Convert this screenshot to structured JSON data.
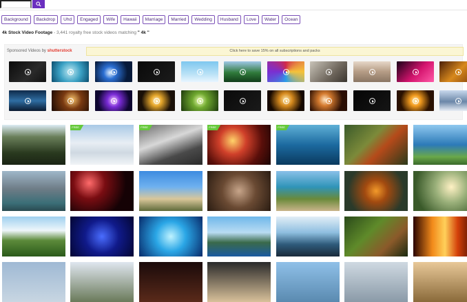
{
  "search": {
    "placeholder": ""
  },
  "tags": [
    "Background",
    "Backdrop",
    "Uhd",
    "Engaged",
    "Wife",
    "Hawaii",
    "Marriage",
    "Married",
    "Wedding",
    "Husband",
    "Love",
    "Water",
    "Ocean"
  ],
  "heading": {
    "title": "4k Stock Video Footage",
    "subtitle": " - 3,441 royalty free stock videos matching ",
    "query": "\" 4k \""
  },
  "sponsor": {
    "label_prefix": "Sponsored Videos by ",
    "brand": "shutterstock",
    "promo": "Click here to save 15% on all subscriptions and packs"
  },
  "sponsored_videos": {
    "row1": [
      {
        "gradient": "linear-gradient(135deg,#0b0b0b,#2a2a2a 60%,#111)"
      },
      {
        "gradient": "radial-gradient(circle at 50% 50%,#bfe9f2,#3ba1c4 50%,#0b4d6e)"
      },
      {
        "gradient": "radial-gradient(circle at 40% 55%,#dfefff,#2b6fd3 25%,#071a3a 70%)"
      },
      {
        "gradient": "linear-gradient(135deg,#0a0a0a,#1b1b1b)"
      },
      {
        "gradient": "linear-gradient(180deg,#7ec7ef,#b8e1f6 60%,#e8f5ff)"
      },
      {
        "gradient": "linear-gradient(180deg,#9ec7e6,#2f7a3a 55%,#123d1a)"
      },
      {
        "gradient": "conic-gradient(from 0deg,#d02a4b,#f5c23a,#2b9ce8,#7a2fd1,#d02a4b)"
      },
      {
        "gradient": "linear-gradient(135deg,#c8c3b8,#6f675d 60%,#3a352e)"
      },
      {
        "gradient": "linear-gradient(180deg,#e6d7c8,#b59c85 50%,#8a7664)"
      },
      {
        "gradient": "linear-gradient(135deg,#1a0018,#d4146e 55%,#ff5aa8)"
      },
      {
        "gradient": "linear-gradient(135deg,#4b1f08,#d8891c 50%,#7a3a0a)"
      }
    ],
    "row2": [
      {
        "gradient": "linear-gradient(180deg,#0f2a4a,#2f6ea3 50%,#0a1a30)"
      },
      {
        "gradient": "radial-gradient(circle at 55% 45%,#f7c26b,#7a3a11 40%,#1a0a03)"
      },
      {
        "gradient": "radial-gradient(circle at 50% 50%,#f2c0ff,#7a2bd6 30%,#0e0630 75%)"
      },
      {
        "gradient": "radial-gradient(circle at 50% 50%,#fff3c9,#e6a72b 25%,#1a1007 70%)"
      },
      {
        "gradient": "radial-gradient(circle at 50% 50%,#ecffb0,#6fa82f 35%,#1d3a0c)"
      },
      {
        "gradient": "linear-gradient(135deg,#0a0a0a,#1a1a1a)"
      },
      {
        "gradient": "radial-gradient(circle at 50% 45%,#ffe9a8,#d5891d 30%,#150800 75%)"
      },
      {
        "gradient": "radial-gradient(circle at 40% 45%,#ffe4c0,#d47a2e 25%,#2a0e03 70%)"
      },
      {
        "gradient": "linear-gradient(135deg,#050505,#151515)"
      },
      {
        "gradient": "radial-gradient(circle at 50% 50%,#fff0b8,#f29b1e 25%,#2a1100 70%)"
      },
      {
        "gradient": "linear-gradient(180deg,#c8d8ec,#6b87a8 55%,#e8eef5)"
      }
    ]
  },
  "grid": [
    [
      {
        "free": false,
        "gradient": "linear-gradient(180deg,#dcecf5 0%,#6a7f5a 30%,#2a3a1f 70%,#1a2414)"
      },
      {
        "free": true,
        "gradient": "linear-gradient(180deg,#a9c9e6,#e8eef4 45%,#cfd9e2 70%,#f1f4f7)"
      },
      {
        "free": true,
        "gradient": "linear-gradient(160deg,#6a6a6a,#d8d8d8 40%,#4a4a4a 70%,#2a2a2a)"
      },
      {
        "free": true,
        "gradient": "radial-gradient(circle at 40% 40%,#ffd36a,#d0402a 30%,#5a0f0a 65%,#1a0504)"
      },
      {
        "free": true,
        "gradient": "linear-gradient(180deg,#5fb0d6,#1c6aa0 50%,#0a3a5e)"
      },
      {
        "free": false,
        "gradient": "linear-gradient(135deg,#3a5a2a,#7c8a3a 40%,#b54a1a 60%,#2a3a1a)"
      },
      {
        "free": false,
        "gradient": "linear-gradient(180deg,#8fc8ef,#2c7ab8 50%,#6aa84a 80%,#3a6a2a)"
      }
    ],
    [
      {
        "free": false,
        "gradient": "linear-gradient(180deg,#9fb7c9,#6e7c86 45%,#3b6f78 80%,#2a4a50)"
      },
      {
        "free": false,
        "gradient": "radial-gradient(circle at 30% 30%,#ff6b6b,#7a0d12 30%,#150205 70%)"
      },
      {
        "free": false,
        "gradient": "linear-gradient(180deg,#3d8be0,#6fb1ef 40%,#d9c79a 70%,#5e6a3a)"
      },
      {
        "free": false,
        "gradient": "radial-gradient(circle at 50% 50%,#c7a58a,#6a4a33 45%,#2a1c12)"
      },
      {
        "free": false,
        "gradient": "linear-gradient(180deg,#8ac0e8,#2f94b8 40%,#6a8a3a 70%,#c9b48a)"
      },
      {
        "free": false,
        "gradient": "radial-gradient(circle at 50% 50%,#f39a2a,#a24a10 30%,#2a3a2a 75%)"
      },
      {
        "free": false,
        "gradient": "radial-gradient(circle at 60% 40%,#fff1c4,#9ab07a 35%,#3a5a2a 80%)"
      }
    ],
    [
      {
        "free": false,
        "gradient": "linear-gradient(180deg,#9ed0ef,#eef6fa 35%,#5c8a3a 60%,#2a5a1a)"
      },
      {
        "free": false,
        "gradient": "radial-gradient(circle at 50% 50%,#4a6dff,#101a8a 45%,#030633)"
      },
      {
        "free": false,
        "gradient": "radial-gradient(circle at 50% 50%,#bff3ff,#2aa6e6 40%,#082a6a)"
      },
      {
        "free": false,
        "gradient": "linear-gradient(180deg,#6fb7ea,#b9dcf3 40%,#3a6a4a 65%,#1a5aa0)"
      },
      {
        "free": false,
        "gradient": "linear-gradient(180deg,#e2eef7,#8fbfe0 40%,#2e5a7a 70%,#1a2a3a)"
      },
      {
        "free": false,
        "gradient": "linear-gradient(135deg,#2a4a1a,#5f8a2a 40%,#8b5a2a 70%,#1a2a10)"
      },
      {
        "free": false,
        "gradient": "linear-gradient(90deg,#2a0500,#f28a1a 30%,#ffd05a 50%,#d4400a 70%,#2a0500)"
      }
    ],
    [
      {
        "free": false,
        "gradient": "linear-gradient(180deg,#9fb9d4,#c8d6e2)"
      },
      {
        "free": false,
        "gradient": "linear-gradient(180deg,#dfe6ef,#6a7a5a)"
      },
      {
        "free": false,
        "gradient": "linear-gradient(180deg,#1a0a0a,#5a2a1a)"
      },
      {
        "free": false,
        "gradient": "linear-gradient(180deg,#2a2a2a,#d9c19a)"
      },
      {
        "free": false,
        "gradient": "linear-gradient(180deg,#8fc0e8,#5a8ab0)"
      },
      {
        "free": false,
        "gradient": "linear-gradient(180deg,#cfd9e2,#8a9aa8)"
      },
      {
        "free": false,
        "gradient": "linear-gradient(180deg,#e8c898,#8a6a3a)"
      }
    ]
  ]
}
